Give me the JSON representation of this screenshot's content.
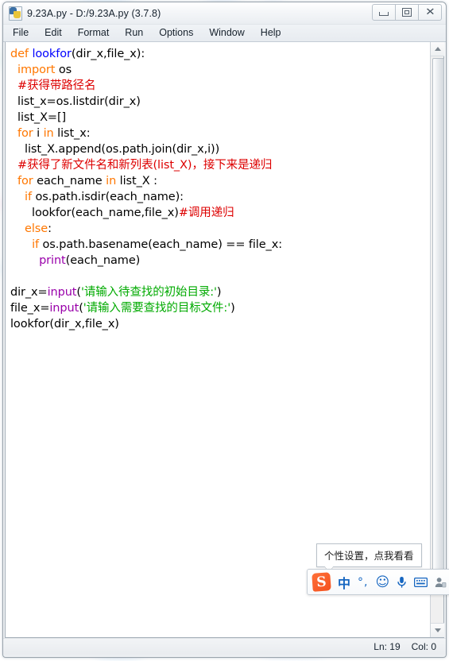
{
  "window": {
    "title": "9.23A.py - D:/9.23A.py (3.7.8)",
    "icon": "python-idle-icon",
    "buttons": {
      "minimize": "minimize",
      "maximize": "restore",
      "close": "close"
    }
  },
  "menubar": {
    "items": [
      {
        "label": "File"
      },
      {
        "label": "Edit"
      },
      {
        "label": "Format"
      },
      {
        "label": "Run"
      },
      {
        "label": "Options"
      },
      {
        "label": "Window"
      },
      {
        "label": "Help"
      }
    ]
  },
  "editor": {
    "lines": [
      [
        {
          "t": "def",
          "c": "kw"
        },
        {
          "t": " ",
          "c": ""
        },
        {
          "t": "lookfor",
          "c": "def"
        },
        {
          "t": "(dir_x,file_x):",
          "c": ""
        }
      ],
      [
        {
          "t": "  ",
          "c": ""
        },
        {
          "t": "import",
          "c": "kw"
        },
        {
          "t": " os",
          "c": ""
        }
      ],
      [
        {
          "t": "  ",
          "c": ""
        },
        {
          "t": "#获得带路径名",
          "c": "cmt"
        }
      ],
      [
        {
          "t": "  list_x=os.listdir(dir_x)",
          "c": ""
        }
      ],
      [
        {
          "t": "  list_X=[]",
          "c": ""
        }
      ],
      [
        {
          "t": "  ",
          "c": ""
        },
        {
          "t": "for",
          "c": "kw"
        },
        {
          "t": " i ",
          "c": ""
        },
        {
          "t": "in",
          "c": "kw"
        },
        {
          "t": " list_x:",
          "c": ""
        }
      ],
      [
        {
          "t": "    list_X.append(os.path.join(dir_x,i))",
          "c": ""
        }
      ],
      [
        {
          "t": "  ",
          "c": ""
        },
        {
          "t": "#获得了新文件名和新列表(list_X)，接下来是递归",
          "c": "cmt"
        }
      ],
      [
        {
          "t": "  ",
          "c": ""
        },
        {
          "t": "for",
          "c": "kw"
        },
        {
          "t": " each_name ",
          "c": ""
        },
        {
          "t": "in",
          "c": "kw"
        },
        {
          "t": " list_X :",
          "c": ""
        }
      ],
      [
        {
          "t": "    ",
          "c": ""
        },
        {
          "t": "if",
          "c": "kw"
        },
        {
          "t": " os.path.isdir(each_name):",
          "c": ""
        }
      ],
      [
        {
          "t": "      lookfor(each_name,file_x)",
          "c": ""
        },
        {
          "t": "#调用递归",
          "c": "cmt"
        }
      ],
      [
        {
          "t": "    ",
          "c": ""
        },
        {
          "t": "else",
          "c": "kw"
        },
        {
          "t": ":",
          "c": ""
        }
      ],
      [
        {
          "t": "      ",
          "c": ""
        },
        {
          "t": "if",
          "c": "kw"
        },
        {
          "t": " os.path.basename(each_name) == file_x:",
          "c": ""
        }
      ],
      [
        {
          "t": "        ",
          "c": ""
        },
        {
          "t": "print",
          "c": "bi"
        },
        {
          "t": "(each_name)",
          "c": ""
        }
      ],
      [
        {
          "t": "",
          "c": ""
        }
      ],
      [
        {
          "t": "dir_x=",
          "c": ""
        },
        {
          "t": "input",
          "c": "bi"
        },
        {
          "t": "(",
          "c": ""
        },
        {
          "t": "'请输入待查找的初始目录:'",
          "c": "str"
        },
        {
          "t": ")",
          "c": ""
        }
      ],
      [
        {
          "t": "file_x=",
          "c": ""
        },
        {
          "t": "input",
          "c": "bi"
        },
        {
          "t": "(",
          "c": ""
        },
        {
          "t": "'请输入需要查找的目标文件:'",
          "c": "str"
        },
        {
          "t": ")",
          "c": ""
        }
      ],
      [
        {
          "t": "lookfor(dir_x,file_x)",
          "c": ""
        }
      ]
    ],
    "syntax_colors": {
      "keyword": "#ff7700",
      "definition": "#0000ff",
      "builtin": "#9900aa",
      "string": "#00aa00",
      "comment": "#dd0000",
      "plain": "#000000"
    }
  },
  "scrollbar": {
    "up_arrow": "scroll-up-arrow",
    "down_arrow": "scroll-down-arrow"
  },
  "statusbar": {
    "line": "Ln: 19",
    "column": "Col: 0"
  },
  "ime": {
    "name": "sogou-input-method",
    "tooltip": "个性设置，点我看看",
    "logo": "S",
    "items": [
      {
        "name": "language-mode",
        "glyph": "中"
      },
      {
        "name": "punctuation-mode",
        "glyph": "°,"
      },
      {
        "name": "emoji",
        "glyph": "☺"
      },
      {
        "name": "voice-input",
        "glyph": "🎤"
      },
      {
        "name": "soft-keyboard",
        "glyph": "⌨"
      },
      {
        "name": "user-account",
        "glyph": "👤"
      },
      {
        "name": "more-menu",
        "glyph": "◂"
      }
    ]
  }
}
